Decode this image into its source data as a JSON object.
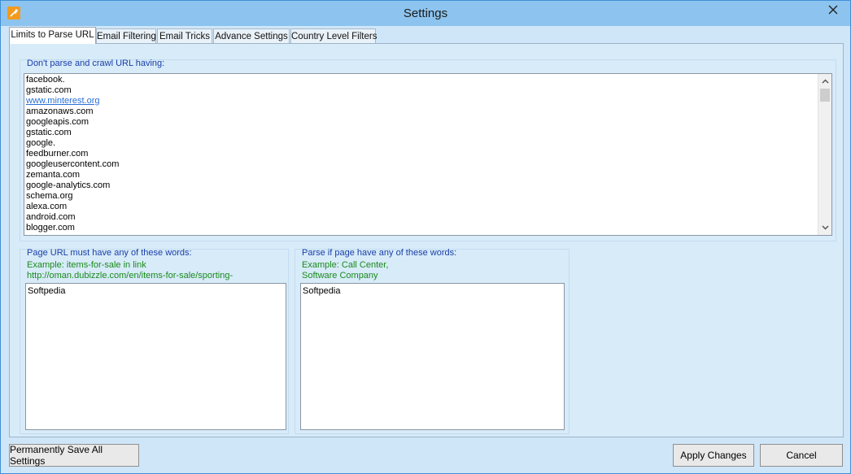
{
  "window": {
    "title": "Settings",
    "app_icon": "wrench-icon",
    "close_icon": "close-icon"
  },
  "tabs": [
    {
      "label": "Limits to Parse URL",
      "active": true
    },
    {
      "label": "Email Filtering",
      "active": false
    },
    {
      "label": "Email Tricks",
      "active": false
    },
    {
      "label": "Advance Settings",
      "active": false
    },
    {
      "label": "Country Level Filters",
      "active": false
    }
  ],
  "exclude_group": {
    "label": "Don't parse and crawl URL having:",
    "items": [
      "facebook.",
      "gstatic.com",
      "www.minterest.org",
      "amazonaws.com",
      "googleapis.com",
      "gstatic.com",
      "google.",
      "feedburner.com",
      "googleusercontent.com",
      "zemanta.com",
      "google-analytics.com",
      "schema.org",
      "alexa.com",
      "android.com",
      "blogger.com"
    ],
    "link_item_index": 2
  },
  "url_words_group": {
    "label": "Page URL must have any of these words:",
    "example": "Example: items-for-sale in link\nhttp://oman.dubizzle.com/en/items-for-sale/sporting-",
    "value": "Softpedia"
  },
  "page_words_group": {
    "label": "Parse if page have any of these words:",
    "example": "Example: Call Center,\nSoftware Company",
    "value": "Softpedia"
  },
  "buttons": {
    "save_all": "Permanently Save All Settings",
    "apply": "Apply Changes",
    "cancel": "Cancel"
  },
  "colors": {
    "titlebar": "#8dc4ef",
    "panel": "#d7ebf9",
    "group_label": "#1a3ea8",
    "example_text": "#1a8a1a",
    "link": "#2a6fd6"
  }
}
